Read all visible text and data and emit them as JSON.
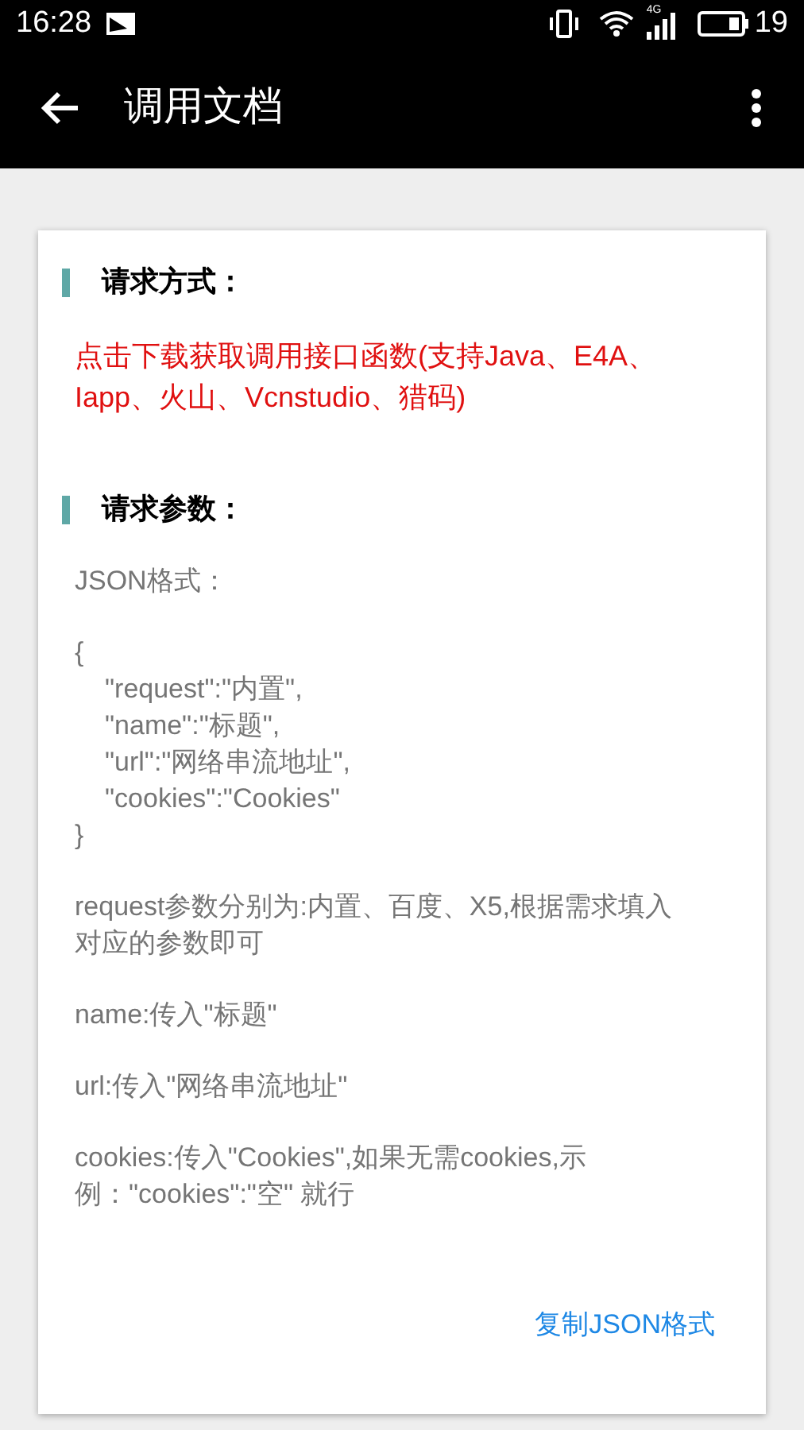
{
  "status_bar": {
    "time": "16:28",
    "signal_label": "4G",
    "battery": "19"
  },
  "app_bar": {
    "title": "调用文档"
  },
  "sections": [
    {
      "title": "请求方式：",
      "kind": "link",
      "text": "点击下载获取调用接口函数(支持Java、E4A、Iapp、火山、Vcnstudio、猎码)"
    },
    {
      "title": "请求参数：",
      "kind": "doc",
      "blocks": [
        {
          "kind": "text",
          "text": "JSON格式："
        },
        {
          "kind": "code",
          "open": "{",
          "fields": [
            "\"request\":\"内置\",",
            "\"name\":\"标题\",",
            "\"url\":\"网络串流地址\",",
            "\"cookies\":\"Cookies\""
          ],
          "close": "}"
        },
        {
          "kind": "text",
          "text": "request参数分别为:内置、百度、X5,根据需求填入对应的参数即可"
        },
        {
          "kind": "text",
          "text": "name:传入\"标题\""
        },
        {
          "kind": "text",
          "text": "url:传入\"网络串流地址\""
        },
        {
          "kind": "text",
          "text": "cookies:传入\"Cookies\",如果无需cookies,示例：\"cookies\":\"空\" 就行"
        }
      ]
    }
  ],
  "copy_button": "复制JSON格式"
}
